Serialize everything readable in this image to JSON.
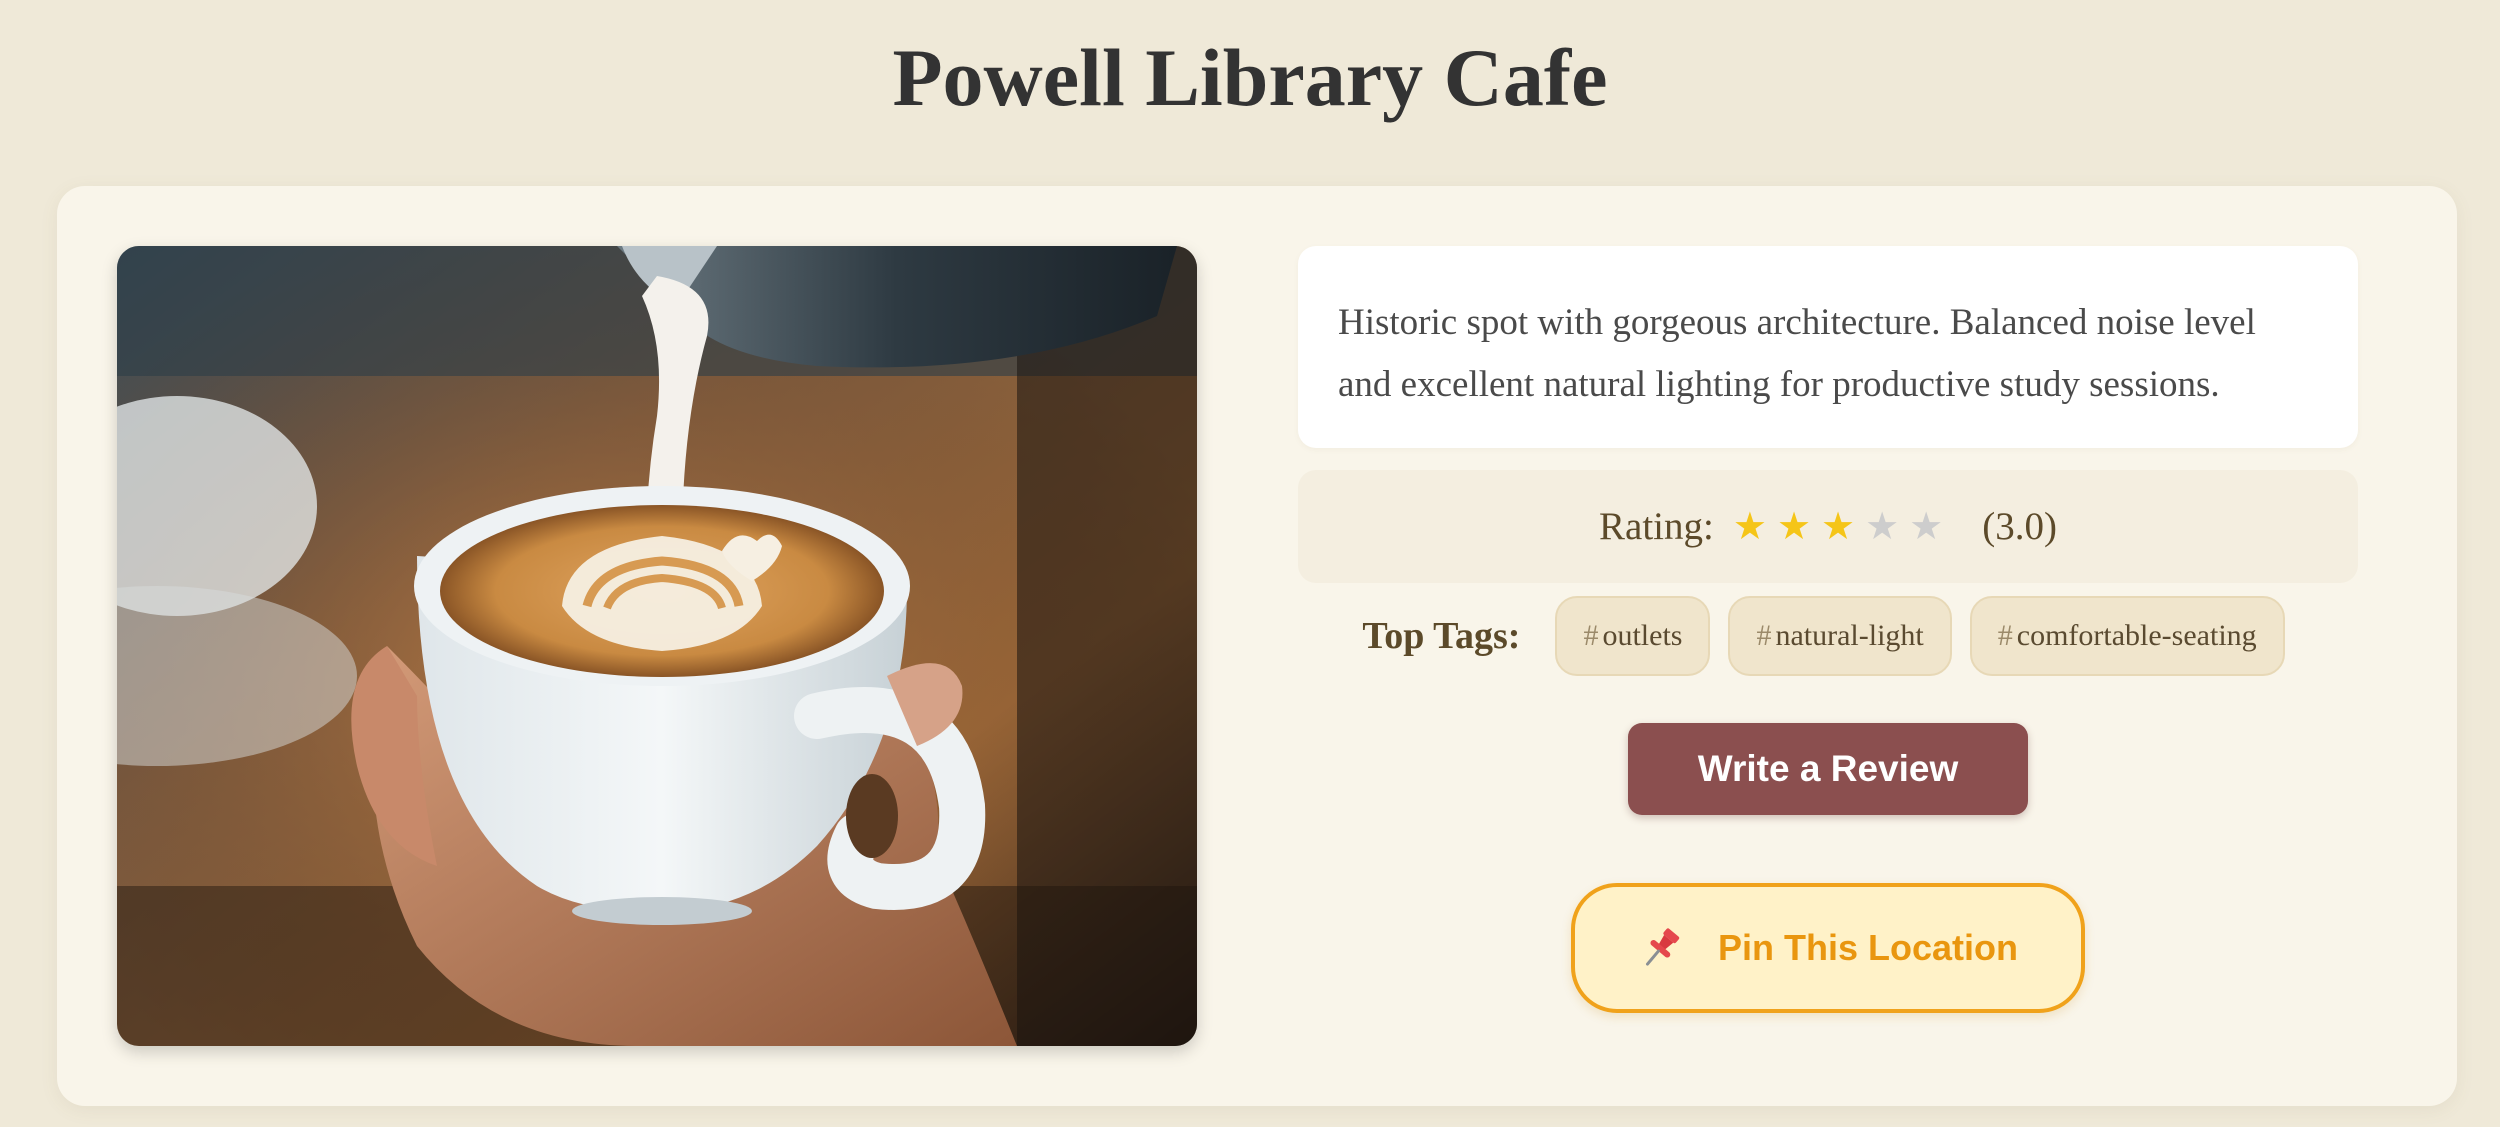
{
  "page": {
    "title": "Powell Library Cafe"
  },
  "cafe": {
    "description": "Historic spot with gorgeous architecture. Balanced noise level and excellent natural lighting for productive study sessions.",
    "photo_icon": "latte-art-photo"
  },
  "rating": {
    "label": "Rating:",
    "value": 3.0,
    "max": 5,
    "display": "(3.0)",
    "star_glyph": "★",
    "colors": {
      "filled": "#f5c518",
      "empty": "#cdcdcd"
    }
  },
  "tags": {
    "label": "Top Tags:",
    "hash": "#",
    "items": [
      "outlets",
      "natural-light",
      "comfortable-seating"
    ]
  },
  "actions": {
    "write_review_label": "Write a Review",
    "pin_label": "Pin This Location",
    "pin_icon": "pushpin-icon"
  },
  "colors": {
    "background": "#efe9d8",
    "card": "#f9f5ea",
    "review_button": "#8b4f4f",
    "pin_accent": "#f0a21b"
  }
}
